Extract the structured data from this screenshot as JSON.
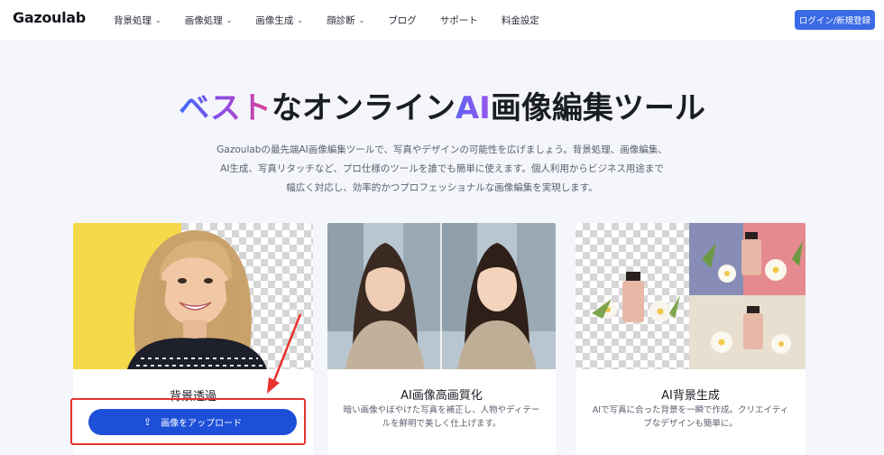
{
  "nav": {
    "logo": "Gazoulab",
    "menu": [
      {
        "label": "背景処理",
        "has_dropdown": true
      },
      {
        "label": "画像処理",
        "has_dropdown": true
      },
      {
        "label": "画像生成",
        "has_dropdown": true
      },
      {
        "label": "顔診断",
        "has_dropdown": true
      },
      {
        "label": "ブログ",
        "has_dropdown": false
      },
      {
        "label": "サポート",
        "has_dropdown": false
      },
      {
        "label": "料金設定",
        "has_dropdown": false
      }
    ],
    "login_label": "ログイン/新規登録"
  },
  "hero": {
    "title_parts": [
      "ベスト",
      "なオンライン",
      "AI",
      "画像編集ツール"
    ],
    "description_lines": [
      "Gazoulabの最先端AI画像編集ツールで、写真やデザインの可能性を広げましょう。背景処理、画像編集、",
      "AI生成、写真リタッチなど、プロ仕様のツールを誰でも簡単に使えます。個人利用からビジネス用途まで",
      "幅広く対応し、効率的かつプロフェッショナルな画像編集を実現します。"
    ]
  },
  "cards": [
    {
      "title": "背景透過",
      "upload_label": "画像をアップロード"
    },
    {
      "title": "AI画像高画質化",
      "description": "暗い画像やぼやけた写真を補正し、人物やディテールを鮮明で美しく仕上げます。"
    },
    {
      "title": "AI背景生成",
      "description": "AIで写真に合った背景を一瞬で作成。クリエイティブなデザインも簡単に。"
    }
  ],
  "colors": {
    "accent": "#3b6ae6",
    "upload_button": "#1d4fd8",
    "highlight": "#e8322f"
  },
  "icons": {
    "dropdown": "chevron-down-icon",
    "upload": "upload-icon"
  }
}
